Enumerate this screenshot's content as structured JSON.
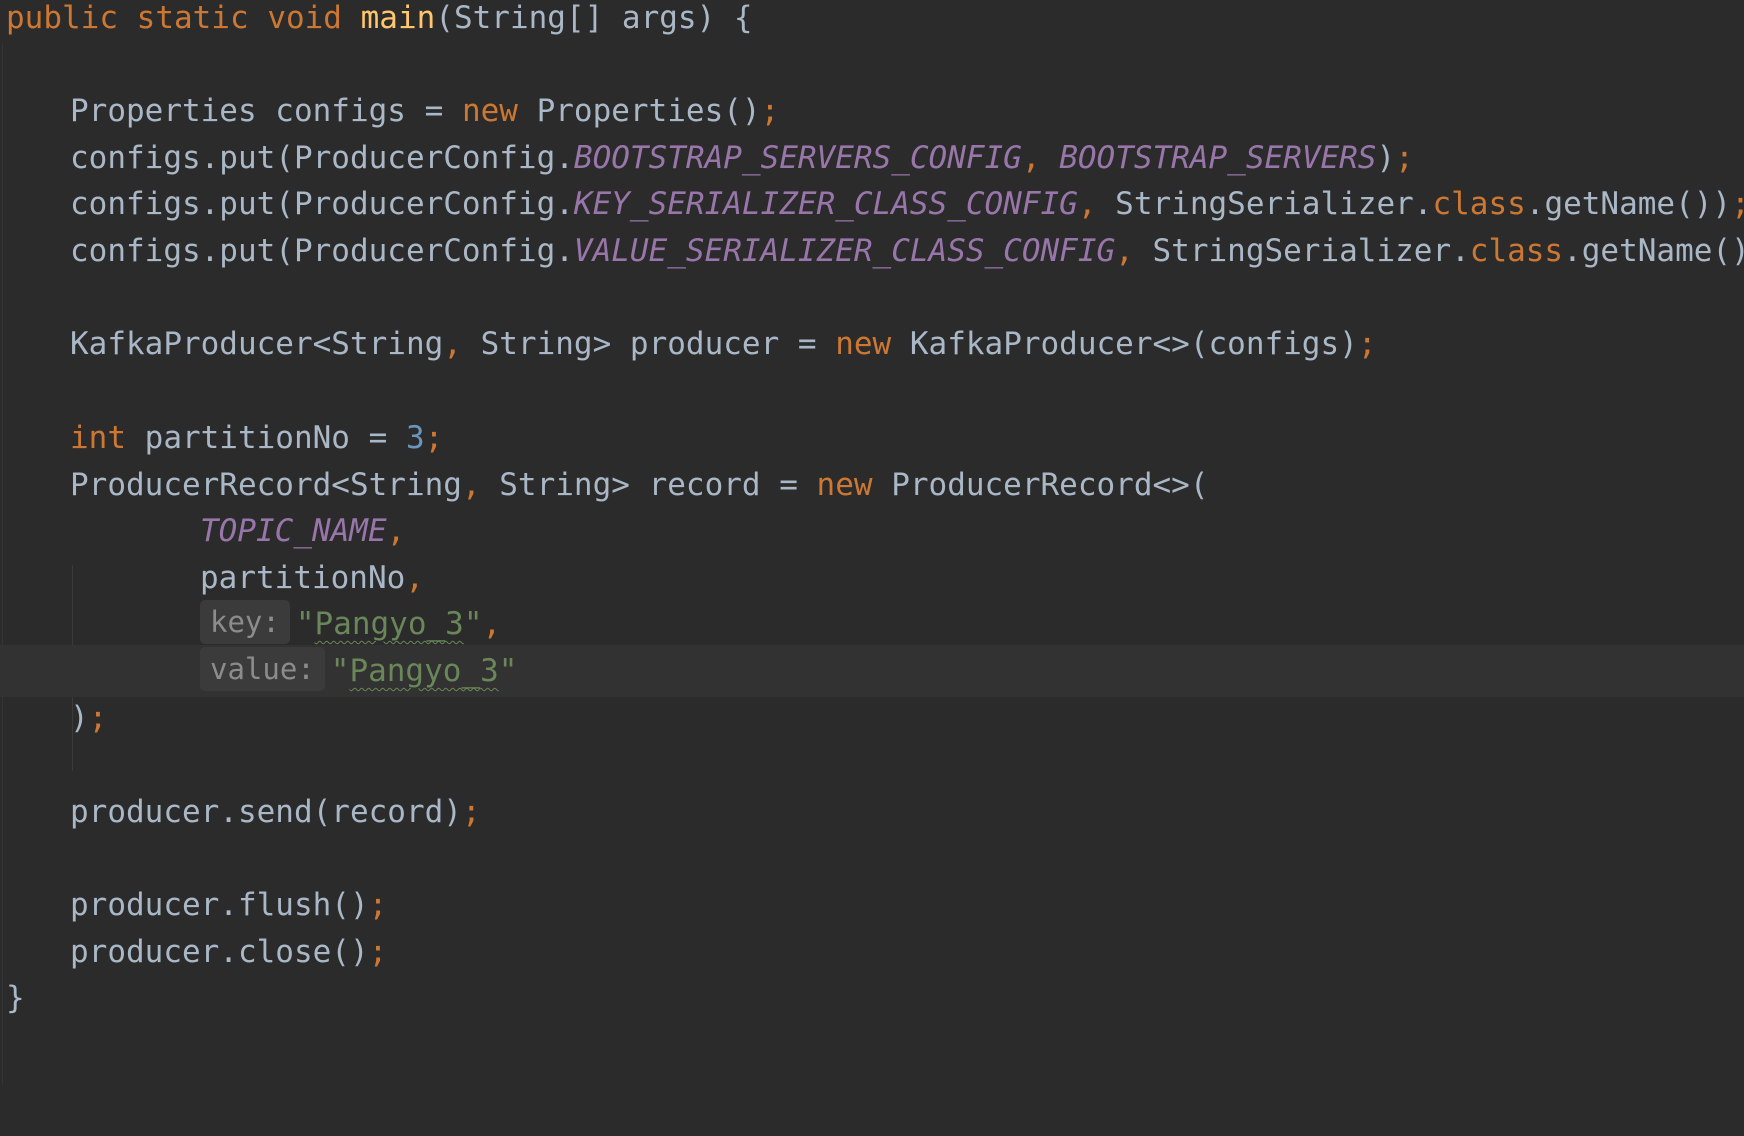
{
  "editor": {
    "language": "java",
    "lines": {
      "l1": {
        "a": "public ",
        "b": "static ",
        "c": "void ",
        "d": "main",
        "e": "(String[] args) {"
      },
      "l2": {
        "a": "Properties configs = ",
        "b": "new ",
        "c": "Properties()",
        "d": ";"
      },
      "l3": {
        "a": "configs.put(ProducerConfig.",
        "b": "BOOTSTRAP_SERVERS_CONFIG",
        "c": ", ",
        "d": "BOOTSTRAP_SERVERS",
        "e": ")",
        "f": ";"
      },
      "l4": {
        "a": "configs.put(ProducerConfig.",
        "b": "KEY_SERIALIZER_CLASS_CONFIG",
        "c": ", ",
        "d": "StringSerializer.",
        "e": "class",
        "f": ".getName())",
        "g": ";"
      },
      "l5": {
        "a": "configs.put(ProducerConfig.",
        "b": "VALUE_SERIALIZER_CLASS_CONFIG",
        "c": ", ",
        "d": "StringSerializer.",
        "e": "class",
        "f": ".getName())",
        "g": ";"
      },
      "l6": {
        "a": "KafkaProducer<String",
        "b": ", ",
        "c": "String> producer = ",
        "d": "new ",
        "e": "KafkaProducer<>(configs)",
        "f": ";"
      },
      "l7": {
        "a": "int ",
        "b": "partitionNo = ",
        "c": "3",
        "d": ";"
      },
      "l8": {
        "a": "ProducerRecord<String",
        "b": ", ",
        "c": "String> record = ",
        "d": "new ",
        "e": "ProducerRecord<>("
      },
      "l9": {
        "a": "TOPIC_NAME",
        "b": ","
      },
      "l10": {
        "a": "partitionNo",
        "b": ","
      },
      "l11": {
        "hint": "key:",
        "q1": "\"",
        "s": "Pangyo_3",
        "q2": "\"",
        "c": ","
      },
      "l12": {
        "hint": "value:",
        "q1": "\"",
        "s": "Pangyo_3",
        "q2": "\""
      },
      "l13": {
        "a": ")",
        "b": ";"
      },
      "l14": {
        "a": "producer.send(record)",
        "b": ";"
      },
      "l15": {
        "a": "producer.flush()",
        "b": ";"
      },
      "l16": {
        "a": "producer.close()",
        "b": ";"
      },
      "l17": {
        "a": "}"
      }
    }
  },
  "colors": {
    "background": "#2b2b2b",
    "keyword": "#cc7832",
    "method_declaration": "#ffc66d",
    "plain_text": "#a9b7c6",
    "constant": "#9876aa",
    "number": "#6897bb",
    "string": "#6a8759",
    "inlay_hint_bg": "#3b3b3b",
    "current_line": "#323232"
  }
}
